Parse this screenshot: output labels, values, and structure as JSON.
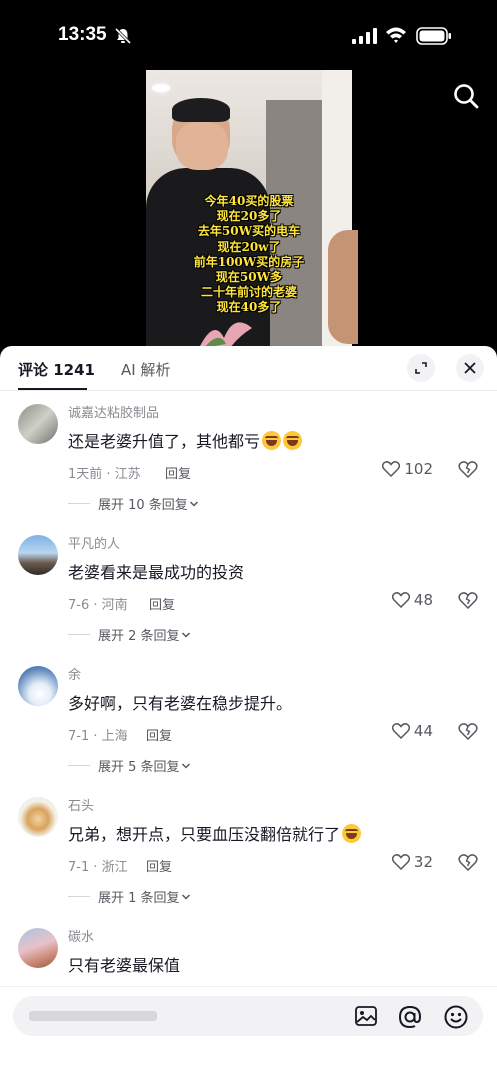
{
  "status_bar": {
    "time": "13:35"
  },
  "video": {
    "caption_lines": [
      "今年40买的股票",
      "现在20多了",
      "去年50W买的电车",
      "现在20w了",
      "前年100W买的房子",
      "现在50W多",
      "二十年前讨的老婆",
      "现在40多了"
    ]
  },
  "tabs": {
    "comments": "评论 1241",
    "ai": "AI 解析"
  },
  "comments": [
    {
      "username": "诚嘉达粘胶制品",
      "text": "还是老婆升值了，其他都亏",
      "meta": "1天前 · 江苏",
      "reply": "回复",
      "likes": "102",
      "expand": "展开 10 条回复"
    },
    {
      "username": "平凡的人",
      "text": "老婆看来是最成功的投资",
      "meta": "7-6 · 河南",
      "reply": "回复",
      "likes": "48",
      "expand": "展开 2 条回复"
    },
    {
      "username": "余",
      "text": "多好啊，只有老婆在稳步提升。",
      "meta": "7-1 · 上海",
      "reply": "回复",
      "likes": "44",
      "expand": "展开 5 条回复"
    },
    {
      "username": "石头",
      "text": "兄弟，想开点，只要血压没翻倍就行了",
      "meta": "7-1 · 浙江",
      "reply": "回复",
      "likes": "32",
      "expand": "展开 1 条回复"
    },
    {
      "username": "碳水",
      "text": "只有老婆最保值"
    }
  ],
  "input": {
    "placeholder": ""
  },
  "icons": [
    "bell-slash-icon",
    "signal-icon",
    "wifi-icon",
    "battery-icon",
    "search-icon",
    "expand-icon",
    "close-icon",
    "heart-icon",
    "dislike-icon",
    "image-icon",
    "at-icon",
    "emoji-icon"
  ]
}
